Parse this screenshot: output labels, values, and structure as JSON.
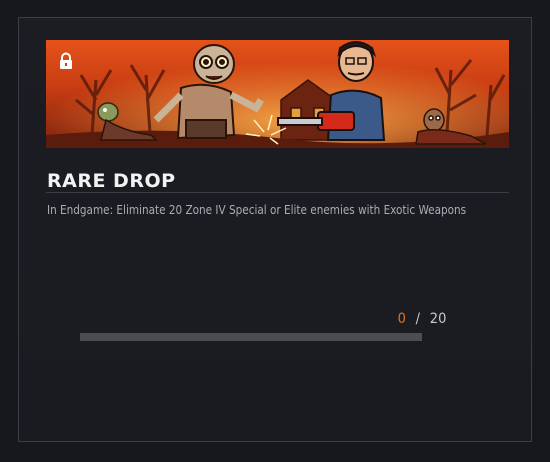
{
  "card": {
    "title": "RARE DROP",
    "description": "In Endgame: Eliminate 20 Zone IV Special or Elite enemies with Exotic Weapons",
    "locked": true,
    "lock_icon": "lock-icon",
    "banner_image": "zombie-chainsaw-illustration"
  },
  "progress": {
    "current": "0",
    "separator": "/",
    "total": "20",
    "fraction": 0.0
  },
  "colors": {
    "accent": "#e8731d",
    "track": "#4a4d52",
    "background": "#16181d"
  }
}
